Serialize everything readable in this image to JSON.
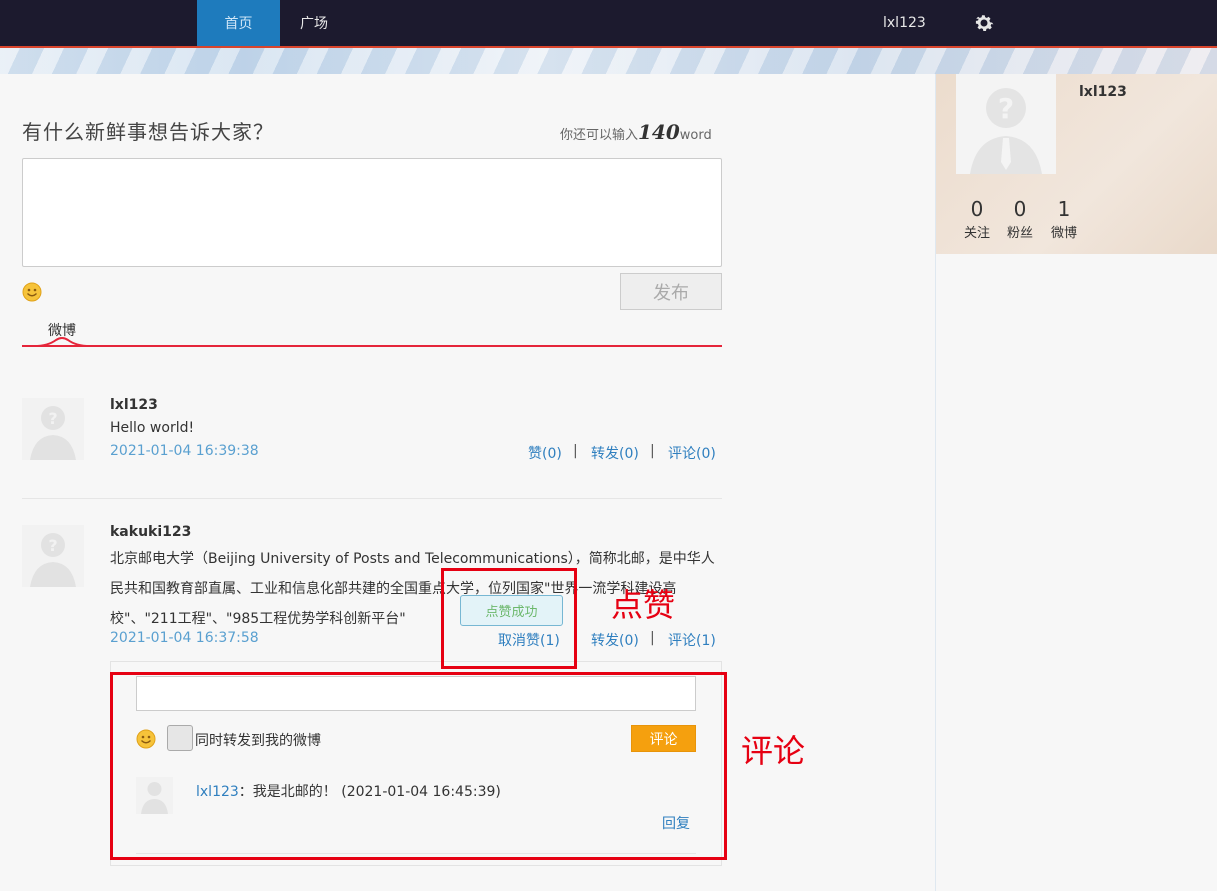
{
  "nav": {
    "home": "首页",
    "square": "广场",
    "username": "lxl123",
    "settings_icon": "gear-icon"
  },
  "composer": {
    "prompt": "有什么新鲜事想告诉大家？",
    "counter_prefix": "你还可以输入",
    "counter_num": "140",
    "counter_suffix": "word",
    "publish_label": "发布"
  },
  "tabs": {
    "weibo": "微博"
  },
  "sidebar": {
    "name": "lxl123",
    "stats": [
      {
        "num": "0",
        "label": "关注"
      },
      {
        "num": "0",
        "label": "粉丝"
      },
      {
        "num": "1",
        "label": "微博"
      }
    ]
  },
  "posts": [
    {
      "user": "lxl123",
      "text": "Hello world!",
      "time": "2021-01-04 16:39:38",
      "like": "赞(0)",
      "repost": "转发(0)",
      "comment": "评论(0)"
    },
    {
      "user": "kakuki123",
      "text": "北京邮电大学（Beijing University of Posts and Telecommunications），简称北邮，是中华人民共和国教育部直属、工业和信息化部共建的全国重点大学，位列国家\"世界一流学科建设高校\"、\"211工程\"、\"985工程优势学科创新平台\"",
      "time": "2021-01-04 16:37:58",
      "unlike": "取消赞(1)",
      "repost": "转发(0)",
      "comment": "评论(1)",
      "toast": "点赞成功"
    }
  ],
  "comment_panel": {
    "repost_label": "同时转发到我的微博",
    "submit_label": "评论",
    "comments": [
      {
        "user": "lxl123",
        "text": "：我是北邮的！ (2021-01-04 16:45:39)",
        "reply": "回复"
      }
    ]
  },
  "annotations": {
    "like": "点赞",
    "comment": "评论"
  },
  "colors": {
    "nav_bg": "#1c1a2e",
    "nav_active": "#1e7bbd",
    "accent_red": "#e60012",
    "link": "#2f7fbf",
    "comment_btn": "#f5a00e"
  }
}
